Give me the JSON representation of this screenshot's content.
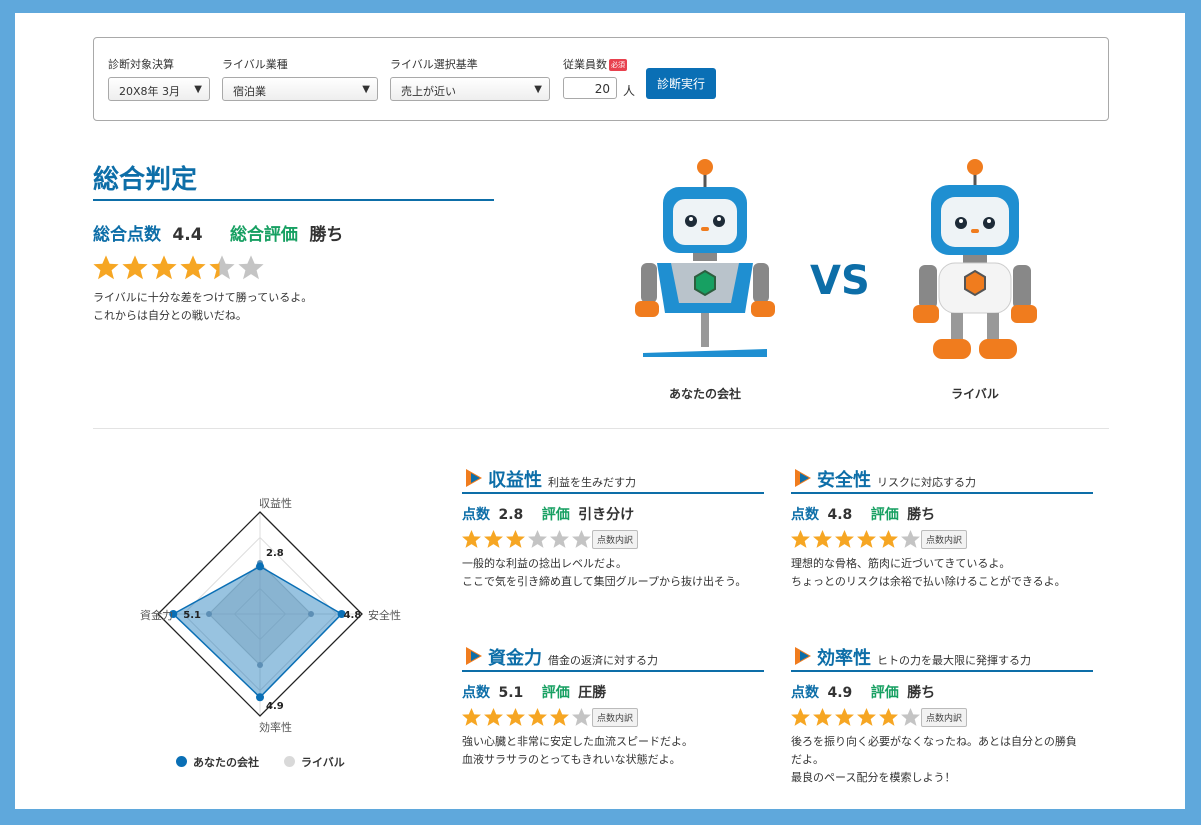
{
  "filter": {
    "target_label": "診断対象決算",
    "target_value": "20X8年 3月",
    "industry_label": "ライバル業種",
    "industry_value": "宿泊業",
    "criteria_label": "ライバル選択基準",
    "criteria_value": "売上が近い",
    "employees_label": "従業員数",
    "required_badge": "必須",
    "employees_value": "20",
    "employees_unit": "人",
    "run_label": "診断実行"
  },
  "overall": {
    "heading": "総合判定",
    "score_label": "総合点数",
    "score_value": "4.4",
    "eval_label": "総合評価",
    "eval_value": "勝ち",
    "stars": 4.4,
    "desc_line1": "ライバルに十分な差をつけて勝っているよ。",
    "desc_line2": "これからは自分との戦いだね。"
  },
  "versus": {
    "vs": "VS",
    "you_caption": "あなたの会社",
    "rival_caption": "ライバル"
  },
  "colors": {
    "primary": "#0d6ea8",
    "eval_green": "#17a062",
    "star_on": "#f6a623",
    "star_off": "#c4c4c4"
  },
  "chart_data": {
    "type": "radar",
    "axes": [
      "収益性",
      "安全性",
      "効率性",
      "資金力"
    ],
    "max": 6,
    "series": [
      {
        "name": "あなたの会社",
        "values": [
          2.8,
          4.8,
          4.9,
          5.1
        ],
        "color": "#0a6fb5"
      },
      {
        "name": "ライバル",
        "values": [
          3,
          3,
          3,
          3
        ],
        "color": "#d9d9d9"
      }
    ],
    "value_labels": [
      "2.8",
      "4.8",
      "4.9",
      "5.1"
    ]
  },
  "categories": [
    {
      "title": "収益性",
      "subtitle": "利益を生みだす力",
      "score_label": "点数",
      "score": "2.8",
      "eval_label": "評価",
      "eval": "引き分け",
      "stars": 3,
      "breakdown": "点数内訳",
      "desc1": "一般的な利益の捻出レベルだよ。",
      "desc2": "ここで気を引き締め直して集団グループから抜け出そう。",
      "desc3": ""
    },
    {
      "title": "安全性",
      "subtitle": "リスクに対応する力",
      "score_label": "点数",
      "score": "4.8",
      "eval_label": "評価",
      "eval": "勝ち",
      "stars": 5,
      "breakdown": "点数内訳",
      "desc1": "理想的な骨格、筋肉に近づいてきているよ。",
      "desc2": "ちょっとのリスクは余裕で払い除けることができるよ。",
      "desc3": ""
    },
    {
      "title": "資金力",
      "subtitle": "借金の返済に対する力",
      "score_label": "点数",
      "score": "5.1",
      "eval_label": "評価",
      "eval": "圧勝",
      "stars": 5,
      "breakdown": "点数内訳",
      "desc1": "強い心臓と非常に安定した血流スピードだよ。",
      "desc2": "血液サラサラのとってもきれいな状態だよ。",
      "desc3": ""
    },
    {
      "title": "効率性",
      "subtitle": "ヒトの力を最大限に発揮する力",
      "score_label": "点数",
      "score": "4.9",
      "eval_label": "評価",
      "eval": "勝ち",
      "stars": 5,
      "breakdown": "点数内訳",
      "desc1": "後ろを振り向く必要がなくなったね。あとは自分との勝負",
      "desc2": "だよ。",
      "desc3": "最良のペース配分を模索しよう！"
    }
  ]
}
